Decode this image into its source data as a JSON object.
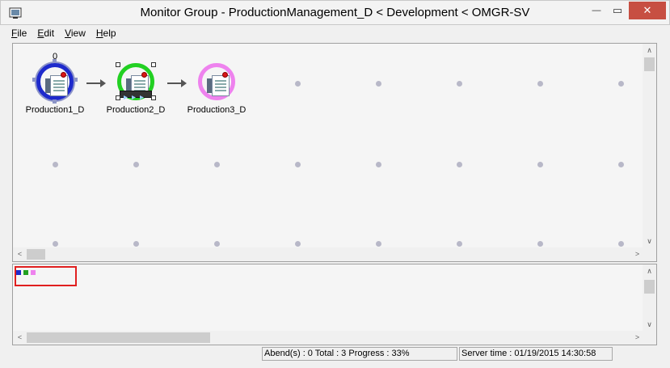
{
  "window": {
    "title": "Monitor Group - ProductionManagement_D < Development < OMGR-SV",
    "minimize_glyph": "—",
    "maximize_glyph": "▭",
    "close_glyph": "✕"
  },
  "menu": {
    "file": "File",
    "edit": "Edit",
    "view": "View",
    "help": "Help"
  },
  "canvas": {
    "nodes": [
      {
        "label": "Production1_D",
        "counter": "0",
        "ring_color": "#1e2acc",
        "icon": "job-document-icon"
      },
      {
        "label": "Production2_D",
        "ring_color": "#22d022",
        "icon": "job-document-icon",
        "state": "running"
      },
      {
        "label": "Production3_D",
        "ring_color": "#ee82ee",
        "icon": "job-document-icon"
      }
    ]
  },
  "overview": {
    "mini_colors": [
      "#1e2acc",
      "#22a022",
      "#ee82ee"
    ]
  },
  "status": {
    "progress_text": "Abend(s) : 0 Total : 3 Progress : 33%",
    "server_time": "Server time : 01/19/2015 14:30:58"
  },
  "colors": {
    "close_button": "#c74f42",
    "viewport_border": "#e02020"
  }
}
